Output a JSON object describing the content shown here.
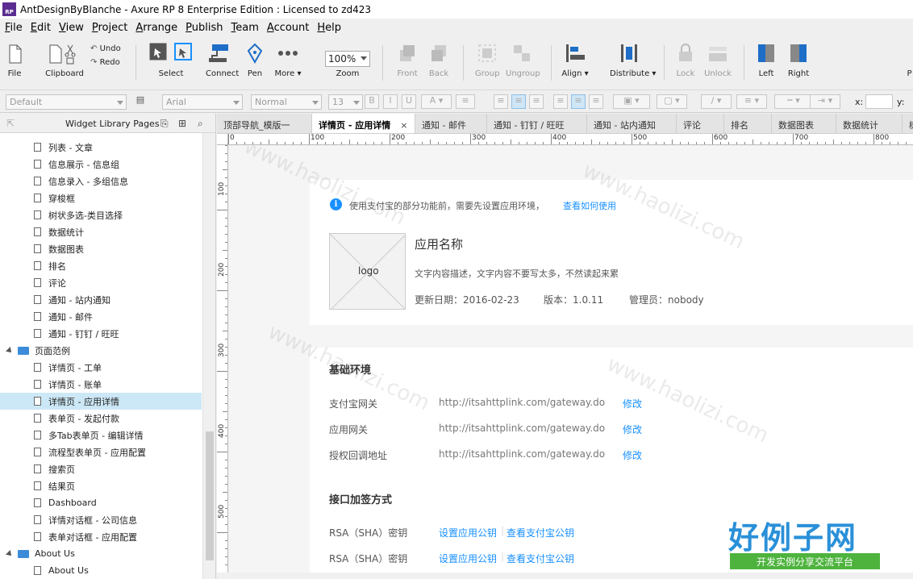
{
  "title_bar": {
    "app_icon": "RP",
    "title": "AntDesignByBlanche - Axure RP 8 Enterprise Edition : Licensed to zd423"
  },
  "menu": [
    {
      "key": "F",
      "rest": "ile"
    },
    {
      "key": "E",
      "rest": "dit"
    },
    {
      "key": "V",
      "rest": "iew"
    },
    {
      "key": "P",
      "rest": "roject"
    },
    {
      "key": "A",
      "rest": "rrange"
    },
    {
      "key": "P",
      "rest": "ublish"
    },
    {
      "key": "T",
      "rest": "eam"
    },
    {
      "key": "A",
      "rest": "ccount"
    },
    {
      "key": "H",
      "rest": "elp"
    }
  ],
  "toolbar": {
    "file": "File",
    "clipboard": "Clipboard",
    "undo": "Undo",
    "redo": "Redo",
    "select": "Select",
    "connect": "Connect",
    "pen": "Pen",
    "more": "More ▾",
    "zoom_value": "100%",
    "zoom": "Zoom",
    "front": "Front",
    "back": "Back",
    "group": "Group",
    "ungroup": "Ungroup",
    "align": "Align ▾",
    "distribute": "Distribute ▾",
    "lock": "Lock",
    "unlock": "Unlock",
    "left": "Left",
    "right": "Right",
    "extra": "P"
  },
  "format_bar": {
    "style": "Default",
    "font": "Arial",
    "weight": "Normal",
    "size": "13",
    "x_label": "x:",
    "y_label": "y:"
  },
  "left_panel": {
    "title": "Widget Library Pages",
    "items": [
      {
        "label": "列表 - 文章",
        "type": "page"
      },
      {
        "label": "信息展示 - 信息组",
        "type": "page"
      },
      {
        "label": "信息录入 - 多组信息",
        "type": "page"
      },
      {
        "label": "穿梭框",
        "type": "page"
      },
      {
        "label": "树状多选-类目选择",
        "type": "page"
      },
      {
        "label": "数据统计",
        "type": "page"
      },
      {
        "label": "数据图表",
        "type": "page"
      },
      {
        "label": "排名",
        "type": "page"
      },
      {
        "label": "评论",
        "type": "page"
      },
      {
        "label": "通知 - 站内通知",
        "type": "page"
      },
      {
        "label": "通知 - 邮件",
        "type": "page"
      },
      {
        "label": "通知 - 钉钉 / 旺旺",
        "type": "page"
      },
      {
        "label": "页面范例",
        "type": "folder"
      },
      {
        "label": "详情页 - 工单",
        "type": "page"
      },
      {
        "label": "详情页 - 账单",
        "type": "page"
      },
      {
        "label": "详情页 - 应用详情",
        "type": "page",
        "selected": true
      },
      {
        "label": "表单页 - 发起付款",
        "type": "page"
      },
      {
        "label": "多Tab表单页 - 编辑详情",
        "type": "page"
      },
      {
        "label": "流程型表单页 - 应用配置",
        "type": "page"
      },
      {
        "label": "搜索页",
        "type": "page"
      },
      {
        "label": "结果页",
        "type": "page"
      },
      {
        "label": "Dashboard",
        "type": "page"
      },
      {
        "label": "详情对话框 - 公司信息",
        "type": "page"
      },
      {
        "label": "表单对话框 - 应用配置",
        "type": "page"
      },
      {
        "label": "About Us",
        "type": "folder"
      },
      {
        "label": "About Us",
        "type": "page"
      }
    ]
  },
  "tabs": [
    {
      "label": "顶部导航_模版一"
    },
    {
      "label": "详情页 - 应用详情",
      "active": true,
      "close": "×"
    },
    {
      "label": "通知 - 邮件"
    },
    {
      "label": "通知 - 钉钉 / 旺旺"
    },
    {
      "label": "通知 - 站内通知"
    },
    {
      "label": "评论"
    },
    {
      "label": "排名"
    },
    {
      "label": "数据图表"
    },
    {
      "label": "数据统计"
    },
    {
      "label": "树"
    }
  ],
  "ruler": {
    "h": [
      "0",
      "100",
      "200",
      "300",
      "400",
      "500",
      "600",
      "700",
      "800"
    ],
    "v": [
      "100",
      "200",
      "300",
      "400",
      "500"
    ]
  },
  "page": {
    "notice_icon": "i",
    "notice_text": "使用支付宝的部分功能前，需要先设置应用环境，",
    "notice_link": "查看如何使用",
    "logo_label": "logo",
    "app_name": "应用名称",
    "app_desc": "文字内容描述，文字内容不要写太多，不然读起来累",
    "update_date": "更新日期：2016-02-23",
    "version": "版本：1.0.11",
    "admin": "管理员：nobody",
    "env_title": "基础环境",
    "env_rows": [
      {
        "label": "支付宝网关",
        "value": "http://itsahttplink.com/gateway.do",
        "action": "修改"
      },
      {
        "label": "应用网关",
        "value": "http://itsahttplink.com/gateway.do",
        "action": "修改"
      },
      {
        "label": "授权回调地址",
        "value": "http://itsahttplink.com/gateway.do",
        "action": "修改"
      }
    ],
    "sign_title": "接口加签方式",
    "sign_rows": [
      {
        "label": "RSA（SHA）密钥",
        "link1": "设置应用公钥",
        "link2": "查看支付宝公钥"
      },
      {
        "label": "RSA（SHA）密钥",
        "link1": "设置应用公钥",
        "link2": "查看支付宝公钥"
      }
    ]
  },
  "watermark": {
    "text": "www.haolizi.com",
    "brand": "好例子网",
    "brand_sub": "开发实例分享交流平台"
  },
  "colors": {
    "accent": "#1890ff",
    "selection": "#cce8f6",
    "brand_purple": "#5b2d90"
  }
}
